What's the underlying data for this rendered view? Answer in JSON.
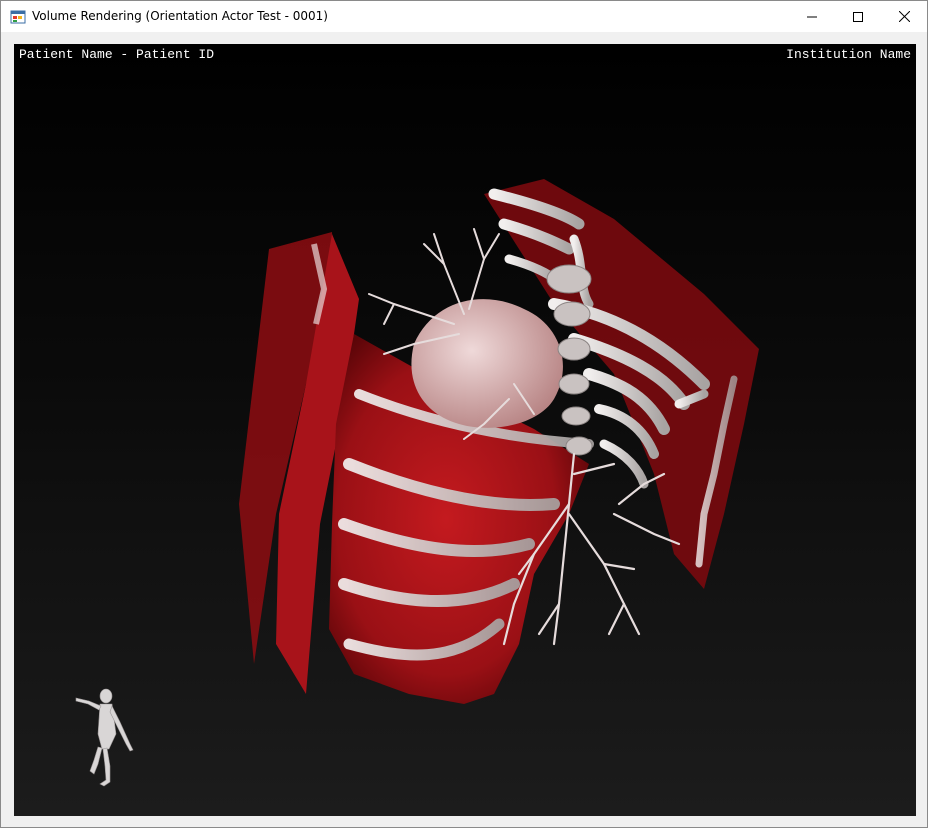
{
  "window": {
    "title": "Volume Rendering (Orientation Actor Test - 0001)",
    "app_icon": "windows-form-icon",
    "controls": {
      "minimize": "minimize-icon",
      "maximize": "maximize-icon",
      "close": "close-icon"
    }
  },
  "viewport": {
    "top_left_text": "Patient Name - Patient ID",
    "top_right_text": "Institution Name",
    "background_top": "#000000",
    "background_bottom": "#1c1c1c"
  },
  "rendering": {
    "subject": "chest-volume-rendering",
    "tissue_color": "#b0141a",
    "bone_color": "#d9d4d2"
  },
  "orientation_actor": {
    "figure": "human-figure-icon"
  }
}
